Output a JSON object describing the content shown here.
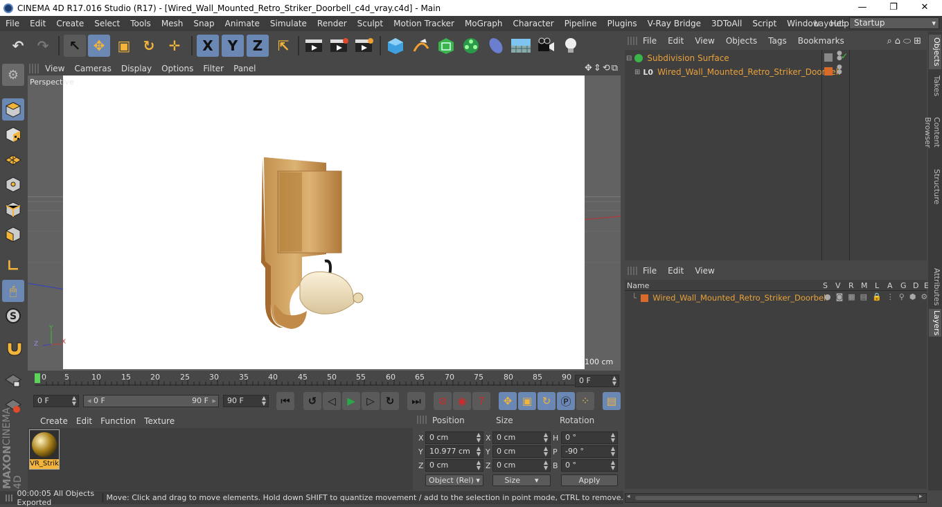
{
  "title_bar": {
    "title": "CINEMA 4D R17.016 Studio (R17) - [Wired_Wall_Mounted_Retro_Striker_Doorbell_c4d_vray.c4d] - Main",
    "minimize": "—",
    "maximize": "❐",
    "close": "✕"
  },
  "menu": [
    "File",
    "Edit",
    "Create",
    "Select",
    "Tools",
    "Mesh",
    "Snap",
    "Animate",
    "Simulate",
    "Render",
    "Sculpt",
    "Motion Tracker",
    "MoGraph",
    "Character",
    "Pipeline",
    "Plugins",
    "V-Ray Bridge",
    "3DToAll",
    "Script",
    "Window",
    "Help"
  ],
  "layout": {
    "label": "Layout:",
    "value": "Startup"
  },
  "toolbar": {
    "undo": "↶",
    "redo": "↷",
    "select": "↖",
    "move": "✥",
    "scale": "▣",
    "rotate": "↻",
    "add": "✛",
    "axis_x": "X",
    "axis_y": "Y",
    "axis_z": "Z",
    "coord": "⇱"
  },
  "viewport": {
    "menu": [
      "View",
      "Cameras",
      "Display",
      "Options",
      "Filter",
      "Panel"
    ],
    "camera_label": "Perspective",
    "scale_label": "100 cm",
    "axis": {
      "y": "Y",
      "z": "Z",
      "x": "X"
    }
  },
  "timeline": {
    "ticks": [
      "0",
      "5",
      "10",
      "15",
      "20",
      "25",
      "30",
      "35",
      "40",
      "45",
      "50",
      "55",
      "60",
      "65",
      "70",
      "75",
      "80",
      "85",
      "90"
    ],
    "frame_end_field": "0 F"
  },
  "transport": {
    "start": "0 F",
    "range_start": "0 F",
    "range_end": "90 F",
    "end": "90 F"
  },
  "material_manager": {
    "menu": [
      "Create",
      "Edit",
      "Function",
      "Texture"
    ],
    "material_name": "VR_Strik"
  },
  "coordinates": {
    "headers": {
      "position": "Position",
      "size": "Size",
      "rotation": "Rotation"
    },
    "rows": [
      {
        "pl": "X",
        "pv": "0 cm",
        "sl": "X",
        "sv": "0 cm",
        "rl": "H",
        "rv": "0 °"
      },
      {
        "pl": "Y",
        "pv": "10.977 cm",
        "sl": "Y",
        "sv": "0 cm",
        "rl": "P",
        "rv": "-90 °"
      },
      {
        "pl": "Z",
        "pv": "0 cm",
        "sl": "Z",
        "sv": "0 cm",
        "rl": "B",
        "rv": "0 °"
      }
    ],
    "mode": "Object (Rel)",
    "size_mode": "Size",
    "apply": "Apply"
  },
  "status": {
    "time": "00:00:05 All Objects Exported",
    "message": "Move: Click and drag to move elements. Hold down SHIFT to quantize movement / add to the selection in point mode, CTRL to remove."
  },
  "object_manager": {
    "menu": [
      "File",
      "Edit",
      "View",
      "Objects",
      "Tags",
      "Bookmarks"
    ],
    "items": [
      {
        "name": "Subdivision Surface"
      },
      {
        "name": "Wired_Wall_Mounted_Retro_Striker_Doorbell"
      }
    ]
  },
  "layer_manager": {
    "menu": [
      "File",
      "Edit",
      "View"
    ],
    "columns": [
      "Name",
      "S",
      "V",
      "R",
      "M",
      "L",
      "A",
      "G",
      "D",
      "E"
    ],
    "layer_name": "Wired_Wall_Mounted_Retro_Striker_Doorbell"
  },
  "right_tabs": [
    "Objects",
    "Takes",
    "Content Browser",
    "Structure",
    "Attributes",
    "Layers"
  ],
  "logo": {
    "line1": "MAXON",
    "line2": "CINEMA 4D"
  },
  "colors": {
    "accent": "#6b88b5",
    "orange": "#e9a13b",
    "layer_swatch": "#d86a2a",
    "timeline_marker": "#5cd45c"
  }
}
